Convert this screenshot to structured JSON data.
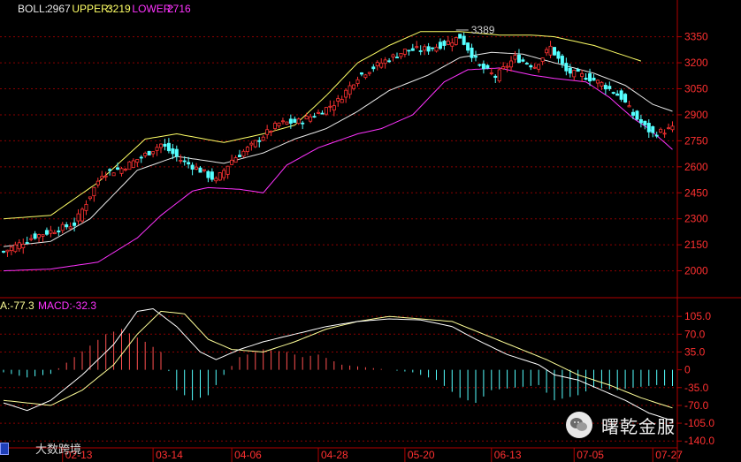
{
  "chart_data": [
    {
      "type": "candlestick",
      "indicator": "BOLL",
      "legend": {
        "boll_label": "BOLL:",
        "boll_value": "2967",
        "upper_label": "UPPER:",
        "upper_value": "3219",
        "lower_label": "LOWER:",
        "lower_value": "2716"
      },
      "ylim": [
        1850,
        3450
      ],
      "yticks": [
        2000,
        2150,
        2300,
        2450,
        2600,
        2750,
        2900,
        3050,
        3200,
        3350
      ],
      "x_tick_labels": [
        "02-13",
        "03-14",
        "04-06",
        "04-28",
        "05-20",
        "06-13",
        "07-05",
        "07-27"
      ],
      "x_tick_index": [
        15,
        38,
        58,
        80,
        102,
        124,
        145,
        165
      ],
      "annotation": {
        "text": "3389",
        "index": 115
      },
      "colors": {
        "up": "#ff3232",
        "down": "#54ffff",
        "mid": "#e8e8e8",
        "upper": "#ffff66",
        "lower": "#ff33ff",
        "grid": "#8b0000",
        "text": "#ff3030"
      },
      "close_anchors": [
        [
          0,
          2110
        ],
        [
          8,
          2200
        ],
        [
          18,
          2270
        ],
        [
          25,
          2560
        ],
        [
          30,
          2590
        ],
        [
          36,
          2670
        ],
        [
          40,
          2730
        ],
        [
          45,
          2640
        ],
        [
          50,
          2580
        ],
        [
          54,
          2520
        ],
        [
          58,
          2640
        ],
        [
          63,
          2720
        ],
        [
          66,
          2780
        ],
        [
          70,
          2850
        ],
        [
          75,
          2860
        ],
        [
          80,
          2910
        ],
        [
          85,
          2980
        ],
        [
          90,
          3120
        ],
        [
          96,
          3200
        ],
        [
          102,
          3270
        ],
        [
          108,
          3280
        ],
        [
          112,
          3310
        ],
        [
          116,
          3350
        ],
        [
          121,
          3180
        ],
        [
          125,
          3120
        ],
        [
          130,
          3230
        ],
        [
          135,
          3180
        ],
        [
          139,
          3290
        ],
        [
          143,
          3150
        ],
        [
          148,
          3120
        ],
        [
          152,
          3080
        ],
        [
          157,
          3000
        ],
        [
          160,
          2900
        ],
        [
          163,
          2830
        ],
        [
          165,
          2790
        ],
        [
          170,
          2820
        ]
      ],
      "mid_anchors": [
        [
          0,
          2140
        ],
        [
          12,
          2170
        ],
        [
          22,
          2300
        ],
        [
          34,
          2580
        ],
        [
          44,
          2660
        ],
        [
          56,
          2620
        ],
        [
          66,
          2680
        ],
        [
          74,
          2760
        ],
        [
          82,
          2820
        ],
        [
          90,
          2920
        ],
        [
          98,
          3040
        ],
        [
          108,
          3130
        ],
        [
          116,
          3230
        ],
        [
          124,
          3260
        ],
        [
          132,
          3250
        ],
        [
          140,
          3200
        ],
        [
          150,
          3140
        ],
        [
          158,
          3070
        ],
        [
          165,
          2960
        ],
        [
          170,
          2920
        ]
      ],
      "upper_anchors": [
        [
          0,
          2300
        ],
        [
          12,
          2320
        ],
        [
          24,
          2510
        ],
        [
          36,
          2760
        ],
        [
          44,
          2790
        ],
        [
          56,
          2740
        ],
        [
          66,
          2790
        ],
        [
          74,
          2840
        ],
        [
          82,
          3010
        ],
        [
          90,
          3200
        ],
        [
          98,
          3300
        ],
        [
          106,
          3380
        ],
        [
          116,
          3380
        ],
        [
          126,
          3360
        ],
        [
          134,
          3360
        ],
        [
          140,
          3350
        ],
        [
          150,
          3300
        ],
        [
          158,
          3240
        ],
        [
          162,
          3210
        ]
      ],
      "lower_anchors": [
        [
          0,
          2000
        ],
        [
          12,
          2010
        ],
        [
          24,
          2050
        ],
        [
          34,
          2190
        ],
        [
          40,
          2320
        ],
        [
          48,
          2460
        ],
        [
          52,
          2480
        ],
        [
          60,
          2470
        ],
        [
          66,
          2450
        ],
        [
          72,
          2610
        ],
        [
          80,
          2710
        ],
        [
          90,
          2790
        ],
        [
          96,
          2820
        ],
        [
          104,
          2900
        ],
        [
          112,
          3090
        ],
        [
          118,
          3160
        ],
        [
          126,
          3170
        ],
        [
          134,
          3130
        ],
        [
          140,
          3110
        ],
        [
          148,
          3090
        ],
        [
          154,
          3000
        ],
        [
          160,
          2880
        ],
        [
          164,
          2820
        ],
        [
          170,
          2700
        ]
      ]
    },
    {
      "type": "macd",
      "indicator": "MACD",
      "legend": {
        "dea_label": "A:",
        "dea_value": "-77.3",
        "macd_label": "MACD:",
        "macd_value": "-32.3"
      },
      "ylim": [
        -150,
        140
      ],
      "yticks": [
        105.0,
        70.0,
        35.0,
        0,
        -35.0,
        -70.0,
        -105.0,
        -140.0
      ],
      "ytick_labels": [
        "105.0",
        "70.0",
        "35.0",
        "0",
        "-35.0",
        "-70.0",
        "-105.0",
        "-140.0"
      ],
      "colors": {
        "dif": "#ffffff",
        "dea": "#ffff99",
        "pos": "#ff5050",
        "neg": "#54ffff",
        "grid": "#8b0000",
        "text": "#ff3030"
      },
      "dif_anchors": [
        [
          0,
          -65
        ],
        [
          6,
          -80
        ],
        [
          12,
          -60
        ],
        [
          20,
          -10
        ],
        [
          28,
          50
        ],
        [
          34,
          115
        ],
        [
          38,
          120
        ],
        [
          44,
          85
        ],
        [
          50,
          35
        ],
        [
          54,
          20
        ],
        [
          60,
          40
        ],
        [
          66,
          55
        ],
        [
          74,
          70
        ],
        [
          82,
          85
        ],
        [
          90,
          95
        ],
        [
          98,
          100
        ],
        [
          106,
          98
        ],
        [
          114,
          85
        ],
        [
          120,
          60
        ],
        [
          128,
          30
        ],
        [
          136,
          10
        ],
        [
          140,
          -10
        ],
        [
          146,
          -20
        ],
        [
          152,
          -40
        ],
        [
          158,
          -60
        ],
        [
          164,
          -85
        ],
        [
          170,
          -100
        ]
      ],
      "dea_anchors": [
        [
          0,
          -60
        ],
        [
          6,
          -65
        ],
        [
          12,
          -70
        ],
        [
          20,
          -40
        ],
        [
          28,
          10
        ],
        [
          34,
          70
        ],
        [
          40,
          115
        ],
        [
          46,
          110
        ],
        [
          52,
          60
        ],
        [
          58,
          40
        ],
        [
          66,
          35
        ],
        [
          74,
          55
        ],
        [
          82,
          80
        ],
        [
          90,
          95
        ],
        [
          98,
          105
        ],
        [
          106,
          100
        ],
        [
          114,
          95
        ],
        [
          122,
          70
        ],
        [
          130,
          45
        ],
        [
          138,
          20
        ],
        [
          146,
          -10
        ],
        [
          154,
          -30
        ],
        [
          162,
          -55
        ],
        [
          170,
          -75
        ]
      ],
      "hist_anchors": [
        [
          0,
          -5
        ],
        [
          6,
          -15
        ],
        [
          12,
          -8
        ],
        [
          18,
          25
        ],
        [
          26,
          70
        ],
        [
          30,
          80
        ],
        [
          36,
          55
        ],
        [
          40,
          35
        ],
        [
          44,
          -40
        ],
        [
          48,
          -60
        ],
        [
          52,
          -50
        ],
        [
          56,
          -10
        ],
        [
          60,
          25
        ],
        [
          66,
          40
        ],
        [
          72,
          35
        ],
        [
          76,
          25
        ],
        [
          80,
          30
        ],
        [
          86,
          10
        ],
        [
          92,
          5
        ],
        [
          98,
          0
        ],
        [
          104,
          -5
        ],
        [
          110,
          -20
        ],
        [
          116,
          -55
        ],
        [
          120,
          -65
        ],
        [
          124,
          -40
        ],
        [
          130,
          -35
        ],
        [
          136,
          -30
        ],
        [
          140,
          -60
        ],
        [
          146,
          -50
        ],
        [
          150,
          -35
        ],
        [
          156,
          -40
        ],
        [
          160,
          -35
        ],
        [
          166,
          -30
        ],
        [
          170,
          -32
        ]
      ]
    }
  ],
  "watermark": {
    "text": "曙乾金服",
    "icon": "wechat-icon"
  },
  "corner_brand": {
    "text": "大数跨境",
    "icon": "app-icon"
  }
}
